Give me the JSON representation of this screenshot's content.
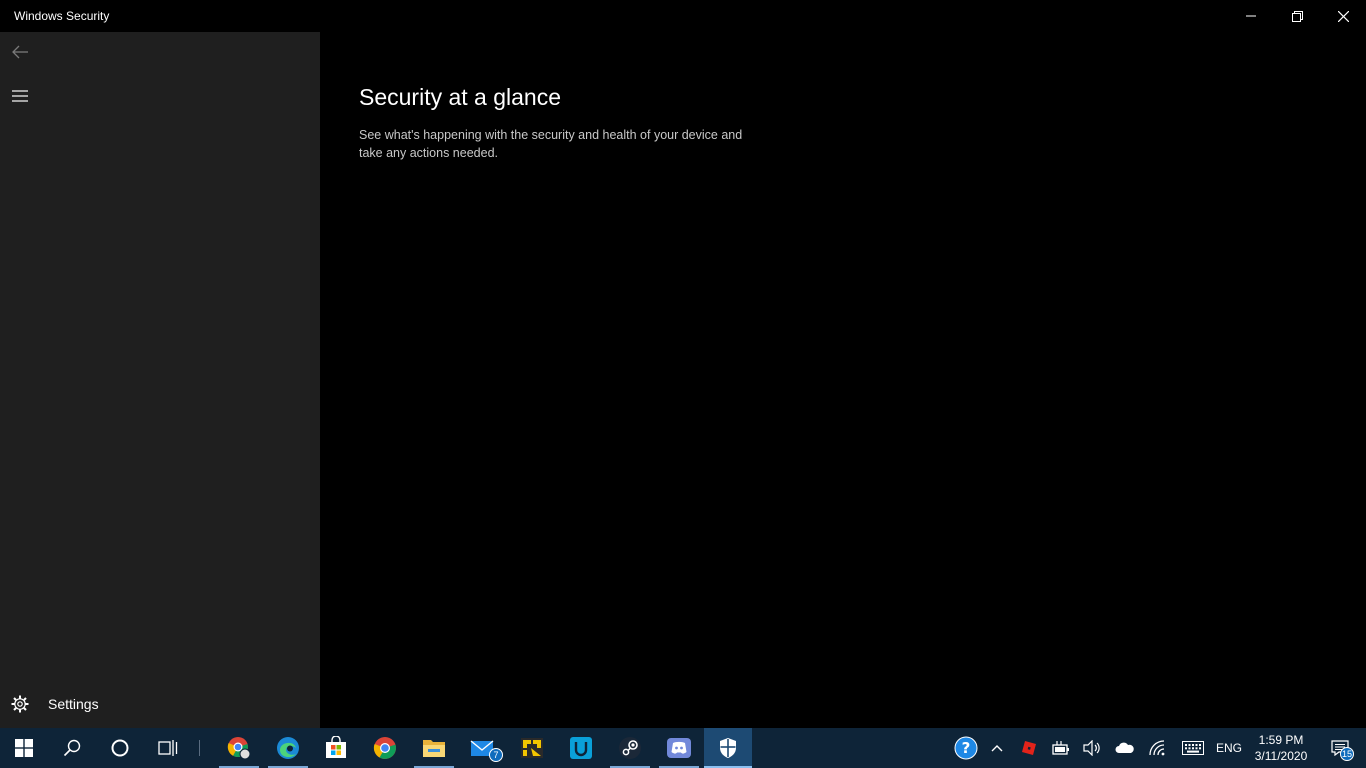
{
  "window": {
    "title": "Windows Security"
  },
  "sidebar": {
    "settings_label": "Settings"
  },
  "main": {
    "title": "Security at a glance",
    "description": "See what's happening with the security and health of your device and take any actions needed."
  },
  "taskbar": {
    "apps": [
      {
        "name": "chrome-profile",
        "running": true
      },
      {
        "name": "edge",
        "running": true
      },
      {
        "name": "microsoft-store",
        "running": false
      },
      {
        "name": "chrome",
        "running": false
      },
      {
        "name": "file-explorer",
        "running": true
      },
      {
        "name": "mail",
        "running": false,
        "badge": "7"
      },
      {
        "name": "game-app",
        "running": false
      },
      {
        "name": "uplay",
        "running": false
      },
      {
        "name": "steam",
        "running": true
      },
      {
        "name": "discord",
        "running": true
      },
      {
        "name": "windows-security",
        "running": true,
        "active": true
      }
    ],
    "mail_badge": "7",
    "tray": {
      "language": "ENG",
      "time": "1:59 PM",
      "date": "3/11/2020",
      "notifications_count": "15"
    }
  },
  "colors": {
    "sidebar_bg": "#1f1f1f",
    "main_bg": "#000000",
    "taskbar_bg": "#0e2438",
    "accent": "#0f6cbd"
  }
}
